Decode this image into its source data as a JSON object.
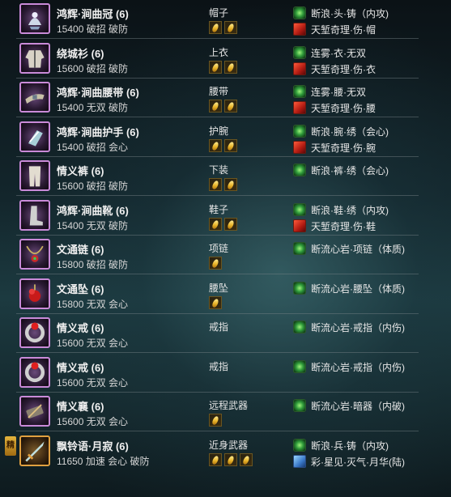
{
  "items": [
    {
      "name": "鸿辉·涧曲冠 (6)",
      "stats": "15400 破招 破防",
      "slot": "帽子",
      "stones": 2,
      "enhance": "断浪·头·铸（内攻)",
      "enchant": "天堑奇理·伤·帽",
      "icon": "hat-icon",
      "quality": "purple"
    },
    {
      "name": "绕城衫 (6)",
      "stats": "15600 破招 破防",
      "slot": "上衣",
      "stones": 2,
      "enhance": "连雾·衣·无双",
      "enchant": "天堑奇理·伤·衣",
      "icon": "robe-icon",
      "quality": "purple"
    },
    {
      "name": "鸿辉·涧曲腰带 (6)",
      "stats": "15400 无双 破防",
      "slot": "腰带",
      "stones": 2,
      "enhance": "连雾·腰·无双",
      "enchant": "天堑奇理·伤·腰",
      "icon": "belt-icon",
      "quality": "purple"
    },
    {
      "name": "鸿辉·涧曲护手 (6)",
      "stats": "15400 破招 会心",
      "slot": "护腕",
      "stones": 2,
      "enhance": "断浪·腕·绣（会心)",
      "enchant": "天堑奇理·伤·腕",
      "icon": "gauntlet-icon",
      "quality": "purple"
    },
    {
      "name": "情义裤 (6)",
      "stats": "15600 破招 破防",
      "slot": "下装",
      "stones": 2,
      "enhance": "断浪·裤·绣（会心)",
      "enchant": "",
      "icon": "pants-icon",
      "quality": "purple"
    },
    {
      "name": "鸿辉·涧曲靴 (6)",
      "stats": "15400 无双 破防",
      "slot": "鞋子",
      "stones": 2,
      "enhance": "断浪·鞋·绣（内攻)",
      "enchant": "天堑奇理·伤·鞋",
      "icon": "boots-icon",
      "quality": "purple"
    },
    {
      "name": "文通链 (6)",
      "stats": "15800 破招 破防",
      "slot": "项链",
      "stones": 1,
      "enhance": "断流心岩·项链（体质)",
      "enchant": "",
      "icon": "necklace-icon",
      "quality": "purple"
    },
    {
      "name": "文通坠 (6)",
      "stats": "15800 无双 会心",
      "slot": "腰坠",
      "stones": 1,
      "enhance": "断流心岩·腰坠（体质)",
      "enchant": "",
      "icon": "pendant-icon",
      "quality": "purple"
    },
    {
      "name": "情义戒 (6)",
      "stats": "15600 无双 会心",
      "slot": "戒指",
      "stones": 0,
      "enhance": "断流心岩·戒指（内伤)",
      "enchant": "",
      "icon": "ring-icon",
      "quality": "purple"
    },
    {
      "name": "情义戒 (6)",
      "stats": "15600 无双 会心",
      "slot": "戒指",
      "stones": 0,
      "enhance": "断流心岩·戒指（内伤)",
      "enchant": "",
      "icon": "ring-icon",
      "quality": "purple"
    },
    {
      "name": "情义襄 (6)",
      "stats": "15600 无双 会心",
      "slot": "远程武器",
      "stones": 1,
      "enhance": "断流心岩·暗器（内破)",
      "enchant": "",
      "icon": "quiver-icon",
      "quality": "purple"
    },
    {
      "name": "飘铃语·月寂 (6)",
      "stats": "11650 加速 会心 破防",
      "slot": "近身武器",
      "stones": 3,
      "enhance": "断浪·兵·铸（内攻)",
      "enchant": "彩·星见·灭气·月华(陆)",
      "icon": "weapon-icon",
      "quality": "orange",
      "tag": "精"
    }
  ]
}
